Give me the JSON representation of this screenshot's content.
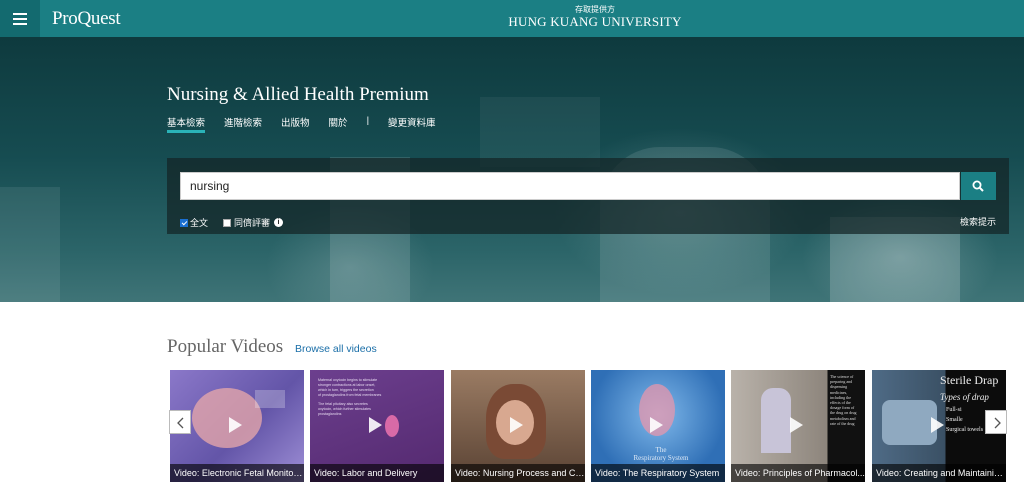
{
  "header": {
    "logo": "ProQuest",
    "institution_subtitle": "存取提供方",
    "institution_name": "HUNG KUANG UNIVERSITY",
    "menu_icon": "hamburger-icon"
  },
  "hero": {
    "database_title": "Nursing & Allied Health Premium",
    "tabs": [
      {
        "label": "基本檢索",
        "active": true
      },
      {
        "label": "進階檢索"
      },
      {
        "label": "出版物"
      },
      {
        "label": "關於"
      }
    ],
    "separator": "|",
    "change_db": "變更資料庫"
  },
  "search": {
    "value": "nursing",
    "button_icon": "search-icon",
    "fulltext_label": "全文",
    "fulltext_checked": true,
    "peer_review_label": "同儕評審",
    "peer_review_checked": false,
    "info_icon": "i",
    "tips": "檢索提示"
  },
  "videos": {
    "heading": "Popular Videos",
    "browse_link": "Browse all videos",
    "items": [
      {
        "caption": "Video: Electronic Fetal Monitori...",
        "color": "#7c6bb8"
      },
      {
        "caption": "Video: Labor and Delivery",
        "color": "#6a3f8a"
      },
      {
        "caption": "Video: Nursing Process and Cri...",
        "color": "#8a6a5a"
      },
      {
        "caption": "Video: The Respiratory System",
        "color": "#3b7fc0"
      },
      {
        "caption": "Video: Principles of Pharmacol...",
        "color": "#9a8f86"
      },
      {
        "caption": "Video: Creating and Maintainin...",
        "color": "#3e5a70"
      }
    ],
    "prev_icon": "chevron-left-icon",
    "next_icon": "chevron-right-icon"
  },
  "thumb_text": {
    "card2_lines": [
      "Maternal oxytocin begins to stimulate",
      "stronger contractions at labor onset,",
      "which in turn, triggers the secretion",
      "of prostaglandins from fetal membranes",
      "The fetal pituitary also secretes",
      "oxytocin, which further stimulates",
      "prostaglandins"
    ],
    "card4_lines": [
      "The",
      "Respiratory System"
    ],
    "card5_lines": [
      "The science of",
      "preparing and",
      "dispensing",
      "medicines,",
      "including the",
      "effects of the",
      "dosage form of",
      "the drug on drug",
      "metabolism and",
      "rate of the drug"
    ],
    "card6_title": "Sterile Drap",
    "card6_sub": "Types of drap",
    "card6_bullets": [
      "Full-si",
      "Smalle",
      "Surgical towels"
    ]
  }
}
